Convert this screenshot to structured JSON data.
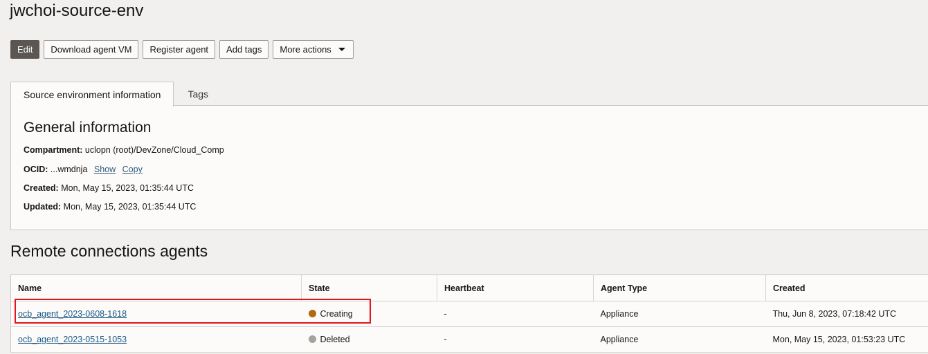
{
  "page": {
    "title": "jwchoi-source-env"
  },
  "toolbar": {
    "edit": "Edit",
    "download": "Download agent VM",
    "register": "Register agent",
    "add_tags": "Add tags",
    "more": "More actions"
  },
  "tabs": [
    {
      "label": "Source environment information",
      "active": true
    },
    {
      "label": "Tags",
      "active": false
    }
  ],
  "general": {
    "heading": "General information",
    "compartment_label": "Compartment:",
    "compartment_value": "uclopn (root)/DevZone/Cloud_Comp",
    "ocid_label": "OCID:",
    "ocid_value": "...wmdnja",
    "ocid_show": "Show",
    "ocid_copy": "Copy",
    "created_label": "Created:",
    "created_value": "Mon, May 15, 2023, 01:35:44 UTC",
    "updated_label": "Updated:",
    "updated_value": "Mon, May 15, 2023, 01:35:44 UTC"
  },
  "agents": {
    "heading": "Remote connections agents",
    "columns": [
      "Name",
      "State",
      "Heartbeat",
      "Agent Type",
      "Created"
    ],
    "rows": [
      {
        "name": "ocb_agent_2023-0608-1618",
        "state": "Creating",
        "state_color": "#b06a14",
        "heartbeat": "-",
        "type": "Appliance",
        "created": "Thu, Jun 8, 2023, 07:18:42 UTC"
      },
      {
        "name": "ocb_agent_2023-0515-1053",
        "state": "Deleted",
        "state_color": "#a6a29d",
        "heartbeat": "-",
        "type": "Appliance",
        "created": "Mon, May 15, 2023, 01:53:23 UTC"
      }
    ]
  },
  "colors": {
    "highlight": "#e3151b",
    "primary_button": "#5b5652"
  }
}
